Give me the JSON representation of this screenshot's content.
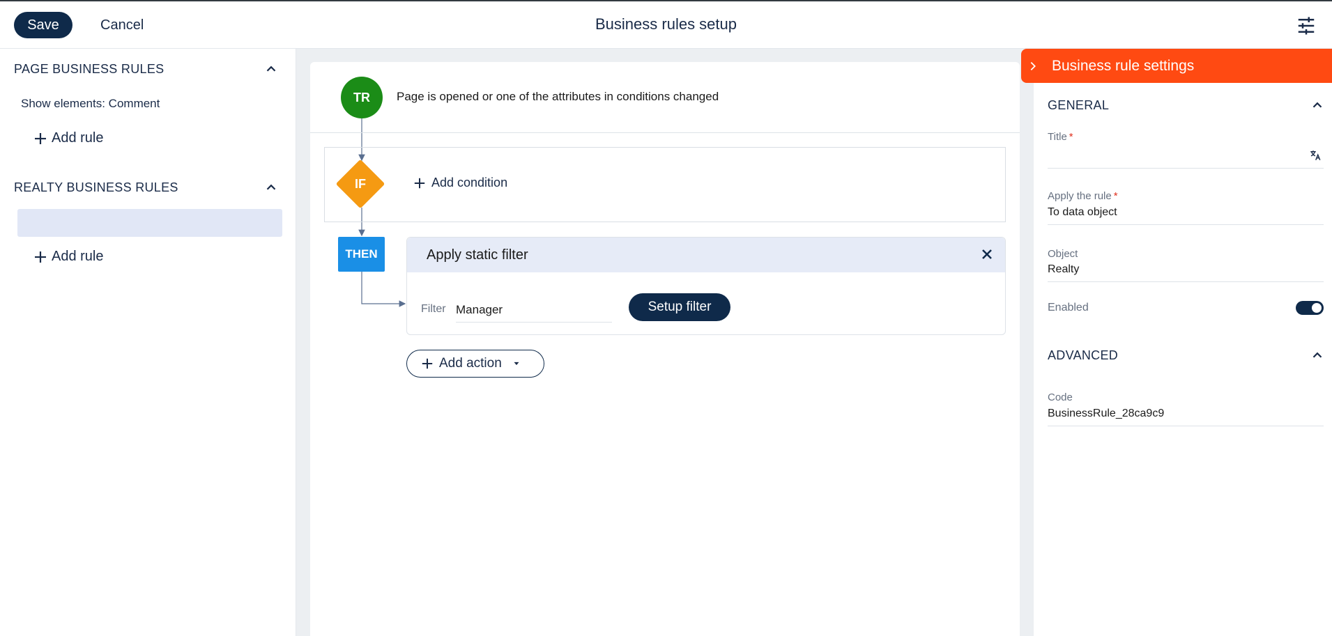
{
  "header": {
    "save_label": "Save",
    "cancel_label": "Cancel",
    "title": "Business rules setup"
  },
  "sidebar": {
    "page_section": {
      "title": "PAGE BUSINESS RULES",
      "rules": [
        "Show elements: Comment"
      ],
      "add_rule_label": "Add rule"
    },
    "realty_section": {
      "title": "REALTY BUSINESS RULES",
      "rules": [
        ""
      ],
      "add_rule_label": "Add rule"
    }
  },
  "canvas": {
    "trigger": {
      "badge": "TR",
      "text": "Page is opened or one of the attributes in conditions changed"
    },
    "condition": {
      "badge": "IF",
      "add_condition_label": "Add condition"
    },
    "then": {
      "badge": "THEN",
      "action": {
        "title": "Apply static filter",
        "filter_label": "Filter",
        "filter_value": "Manager",
        "setup_filter_label": "Setup filter"
      },
      "add_action_label": "Add action"
    }
  },
  "settings_panel": {
    "title": "Business rule settings",
    "general": {
      "title": "GENERAL",
      "title_field_label": "Title",
      "title_field_value": "",
      "apply_rule_label": "Apply the rule",
      "apply_rule_value": "To data object",
      "object_label": "Object",
      "object_value": "Realty",
      "enabled_label": "Enabled",
      "enabled": true
    },
    "advanced": {
      "title": "ADVANCED",
      "code_label": "Code",
      "code_value": "BusinessRule_28ca9c9"
    }
  },
  "colors": {
    "primary": "#0f2a4a",
    "accent": "#ff4a12",
    "trigger": "#1b8c17",
    "condition": "#f59a12",
    "then": "#1a8fe6",
    "selected": "#e1e7f6"
  }
}
